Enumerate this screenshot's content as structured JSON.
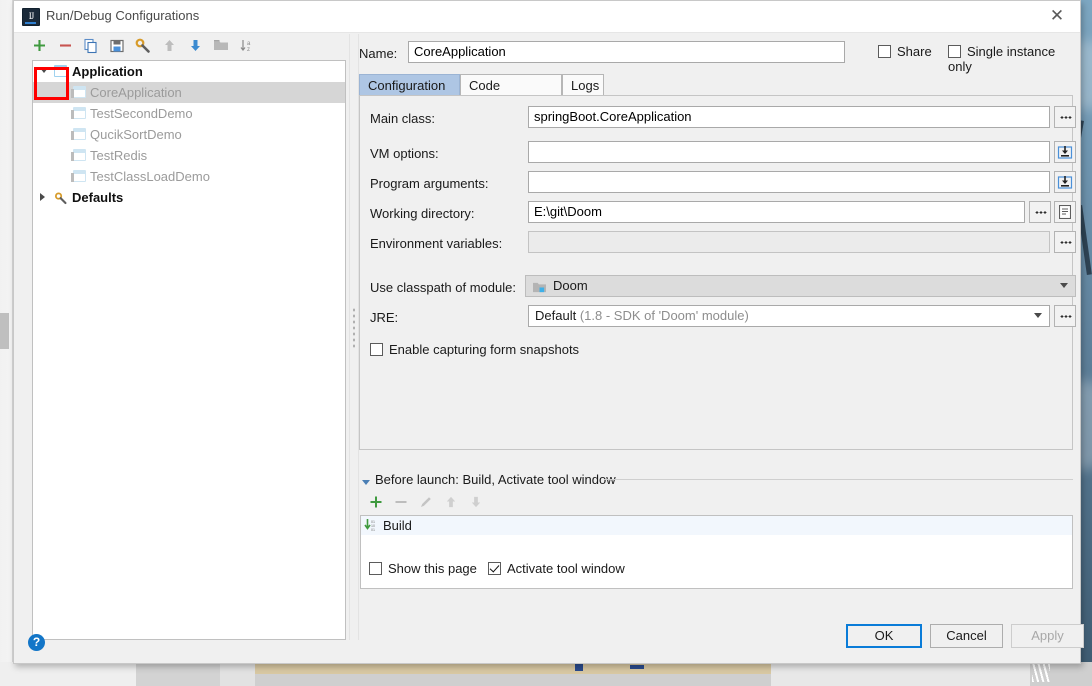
{
  "window": {
    "title": "Run/Debug Configurations",
    "app_icon": "intellij-idea-icon",
    "close_label": "✕"
  },
  "toolbar": {
    "buttons": [
      {
        "name": "add-configuration-button",
        "icon": "plus-icon",
        "label": "+"
      },
      {
        "name": "remove-configuration-button",
        "icon": "minus-icon",
        "label": "−"
      },
      {
        "name": "copy-configuration-button",
        "icon": "copy-icon",
        "label": ""
      },
      {
        "name": "save-configuration-button",
        "icon": "save-icon",
        "label": ""
      },
      {
        "name": "edit-defaults-button",
        "icon": "wrench-icon",
        "label": ""
      },
      {
        "name": "move-up-button",
        "icon": "arrow-up-icon",
        "label": ""
      },
      {
        "name": "move-down-button",
        "icon": "arrow-down-icon",
        "label": ""
      },
      {
        "name": "move-into-folder-button",
        "icon": "folder-icon",
        "label": ""
      },
      {
        "name": "sort-alphabetically-button",
        "icon": "sort-az-icon",
        "label": ""
      }
    ]
  },
  "tree": {
    "nodes": [
      {
        "label": "Application",
        "icon": "application-group-icon",
        "level": 0,
        "bold": true,
        "selected": false,
        "expanded": true
      },
      {
        "label": "CoreApplication",
        "icon": "application-config-icon",
        "level": 1,
        "bold": false,
        "selected": true
      },
      {
        "label": "TestSecondDemo",
        "icon": "application-config-icon",
        "level": 1,
        "bold": false,
        "selected": false
      },
      {
        "label": "QucikSortDemo",
        "icon": "application-config-icon",
        "level": 1,
        "bold": false,
        "selected": false
      },
      {
        "label": "TestRedis",
        "icon": "application-config-icon",
        "level": 1,
        "bold": false,
        "selected": false
      },
      {
        "label": "TestClassLoadDemo",
        "icon": "application-config-icon",
        "level": 1,
        "bold": false,
        "selected": false
      },
      {
        "label": "Defaults",
        "icon": "defaults-wrench-icon",
        "level": 0,
        "bold": true,
        "selected": false,
        "expanded": false
      }
    ]
  },
  "form": {
    "name_label": "Name:",
    "name_value": "CoreApplication",
    "share_label": "Share",
    "share_checked": false,
    "single_instance_label": "Single instance only",
    "single_instance_checked": false,
    "tabs": [
      {
        "label": "Configuration",
        "active": true
      },
      {
        "label": "Code Coverage",
        "active": false
      },
      {
        "label": "Logs",
        "active": false
      }
    ],
    "fields": {
      "main_class_label": "Main class:",
      "main_class_value": "springBoot.CoreApplication",
      "vm_options_label": "VM options:",
      "vm_options_value": "",
      "program_arguments_label": "Program arguments:",
      "program_arguments_value": "",
      "working_directory_label": "Working directory:",
      "working_directory_value": "E:\\git\\Doom",
      "environment_variables_label": "Environment variables:",
      "environment_variables_value": "",
      "use_classpath_label": "Use classpath of module:",
      "use_classpath_value": "Doom",
      "jre_label": "JRE:",
      "jre_value": "Default",
      "jre_hint": "(1.8 - SDK of 'Doom' module)",
      "enable_snapshots_label": "Enable capturing form snapshots",
      "enable_snapshots_checked": false
    }
  },
  "before_launch": {
    "title": "Before launch: Build, Activate tool window",
    "toolbar": [
      {
        "name": "add-task-button",
        "icon": "plus-icon"
      },
      {
        "name": "remove-task-button",
        "icon": "minus-icon"
      },
      {
        "name": "edit-task-button",
        "icon": "pencil-icon"
      },
      {
        "name": "move-task-up-button",
        "icon": "arrow-up-icon"
      },
      {
        "name": "move-task-down-button",
        "icon": "arrow-down-icon"
      }
    ],
    "tasks": [
      {
        "label": "Build",
        "icon": "build-icon"
      }
    ],
    "show_page_label": "Show this page",
    "show_page_checked": false,
    "activate_tool_window_label": "Activate tool window",
    "activate_tool_window_checked": true
  },
  "footer": {
    "help_label": "?",
    "ok_label": "OK",
    "cancel_label": "Cancel",
    "apply_label": "Apply",
    "apply_enabled": false
  },
  "colors": {
    "accent_blue": "#0a7cd8",
    "selection_grey": "#d6d6d6",
    "tab_active": "#aec6e4",
    "highlight_red": "#ff0000",
    "green_plus": "#3f9a3f",
    "red_minus": "#c75450"
  }
}
